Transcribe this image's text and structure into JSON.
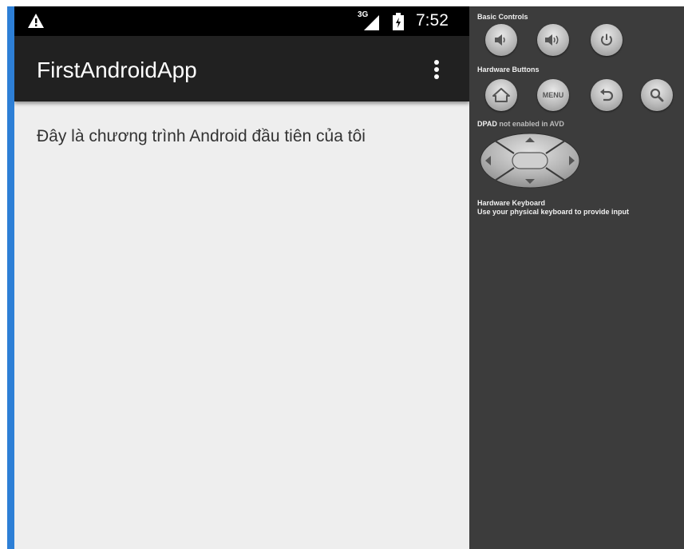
{
  "statusbar": {
    "network": "3G",
    "time": "7:52"
  },
  "actionbar": {
    "title": "FirstAndroidApp"
  },
  "content": {
    "text": "Đây là chương trình Android đầu tiên của tôi"
  },
  "panel": {
    "basic_controls_label": "Basic Controls",
    "hardware_buttons_label": "Hardware Buttons",
    "menu_button_label": "MENU",
    "dpad_label_bold": "DPAD",
    "dpad_label_note": "not enabled in AVD",
    "keyboard_title": "Hardware Keyboard",
    "keyboard_hint": "Use your physical keyboard to provide input"
  },
  "colors": {
    "accent_strip": "#2d7fd6",
    "statusbar_bg": "#000000",
    "actionbar_bg": "#212121",
    "screen_bg": "#eeeeee",
    "panel_bg": "#3c3c3c"
  }
}
